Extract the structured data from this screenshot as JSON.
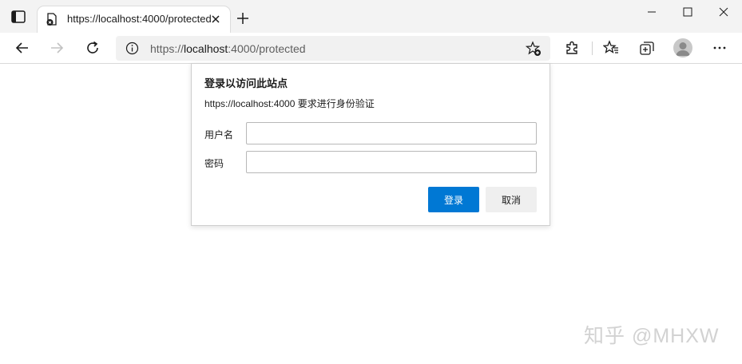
{
  "browser": {
    "tab": {
      "title": "https://localhost:4000/protected"
    },
    "address_bar": {
      "scheme": "https://",
      "host": "localhost",
      "rest": ":4000/protected"
    },
    "icons": {
      "tab_actions": "tab-actions-icon",
      "back": "back-arrow-icon",
      "forward": "forward-arrow-icon",
      "refresh": "refresh-icon",
      "site_info": "info-icon",
      "add_favorite": "add-favorite-star-icon",
      "extensions": "extensions-puzzle-icon",
      "favorites": "favorites-star-icon",
      "collections": "collections-icon",
      "profile": "profile-avatar-icon",
      "more": "more-dots-icon"
    }
  },
  "auth_dialog": {
    "title": "登录以访问此站点",
    "description": "https://localhost:4000 要求进行身份验证",
    "username_label": "用户名",
    "username_value": "",
    "password_label": "密码",
    "password_value": "",
    "login_button": "登录",
    "cancel_button": "取消",
    "primary_color": "#0078d4"
  },
  "watermark": "知乎 @MHXW"
}
